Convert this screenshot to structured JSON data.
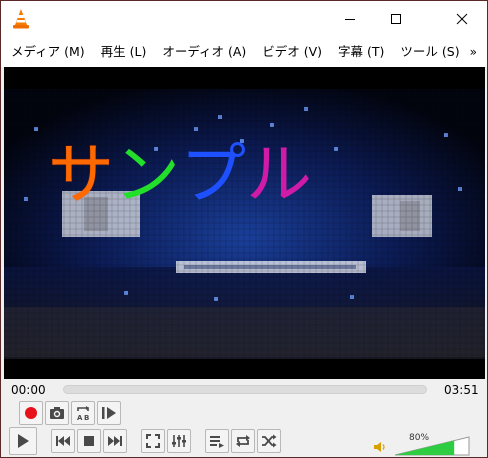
{
  "window": {
    "menu": [
      "メディア (M)",
      "再生 (L)",
      "オーディオ (A)",
      "ビデオ (V)",
      "字幕 (T)",
      "ツール (S)"
    ],
    "menu_overflow": "»"
  },
  "subtitle": {
    "chars": [
      "サ",
      "ン",
      "プ",
      "ル"
    ]
  },
  "playback": {
    "elapsed": "00:00",
    "total": "03:51",
    "progress": 0.0
  },
  "volume": {
    "label": "80%",
    "level": 0.8
  },
  "icons": {
    "app": "vlc-cone-icon",
    "record": "record-icon",
    "snapshot": "camera-icon",
    "loop_ab": "ab-loop-icon",
    "frame_step": "frame-step-icon",
    "play": "play-icon",
    "previous": "previous-icon",
    "stop": "stop-icon",
    "next": "next-icon",
    "fullscreen": "fullscreen-icon",
    "extended": "equalizer-icon",
    "playlist": "playlist-icon",
    "loop": "loop-icon",
    "shuffle": "shuffle-icon",
    "speaker": "speaker-icon"
  },
  "colors": {
    "record_red": "#e8101a",
    "volume_green": "#2ecc40"
  }
}
